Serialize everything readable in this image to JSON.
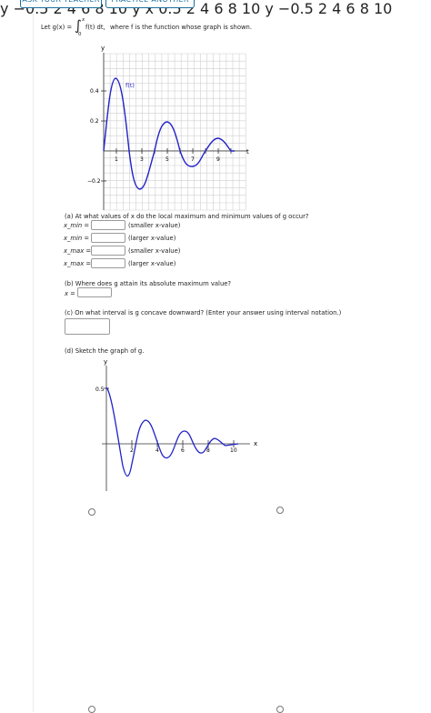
{
  "top_buttons": [
    "ASK YOUR TEACHER",
    "PRACTICE ANOTHER"
  ],
  "intro": {
    "prefix": "Let g(x) =",
    "integral_sign": "∫",
    "upper_limit": "x",
    "lower_limit": "0",
    "integrand": "f(t) dt,",
    "suffix": "where f is the function whose graph is shown."
  },
  "main_graph": {
    "y_label": "y",
    "x_label": "t",
    "curve_label": "f(t)",
    "x_ticks": [
      "1",
      "3",
      "5",
      "7",
      "9"
    ],
    "y_ticks": [
      "0.4",
      "0.2",
      "−0.2"
    ]
  },
  "part_a": {
    "question": "(a) At what values of x do the local maximum and minimum values of g occur?",
    "rows": [
      {
        "label": "x_min =",
        "hint": "(smaller x-value)"
      },
      {
        "label": "x_min =",
        "hint": "(larger x-value)"
      },
      {
        "label": "x_max =",
        "hint": "(smaller x-value)"
      },
      {
        "label": "x_max =",
        "hint": "(larger x-value)"
      }
    ]
  },
  "part_b": {
    "question": "(b) Where does g attain its absolute maximum value?",
    "label": "x ="
  },
  "part_c": {
    "question": "(c) On what interval is g concave downward? (Enter your answer using interval notation.)"
  },
  "part_d": {
    "question": "(d) Sketch the graph of g."
  },
  "options": [
    {
      "y_label": "y",
      "x_label": "x",
      "x_ticks": [
        "2",
        "4",
        "6",
        "8",
        "10"
      ],
      "y_ticks": [
        "0.5"
      ]
    },
    {
      "y_label": "y",
      "x_label": "",
      "x_ticks": [
        "2",
        "4",
        "6",
        "8",
        "10"
      ],
      "y_ticks": [
        "−0.5"
      ]
    },
    {
      "y_label": "y",
      "x_label": "x",
      "x_ticks": [
        "2",
        "4",
        "6",
        "8",
        "10"
      ],
      "y_ticks": [
        "0.5"
      ]
    },
    {
      "y_label": "y",
      "x_label": "",
      "x_ticks": [
        "2",
        "4",
        "6",
        "8",
        "10"
      ],
      "y_ticks": [
        "−0.5"
      ]
    }
  ],
  "colors": {
    "curve": "#2323c8",
    "grid": "#cfcfcf",
    "button": "#1a6f9e"
  }
}
